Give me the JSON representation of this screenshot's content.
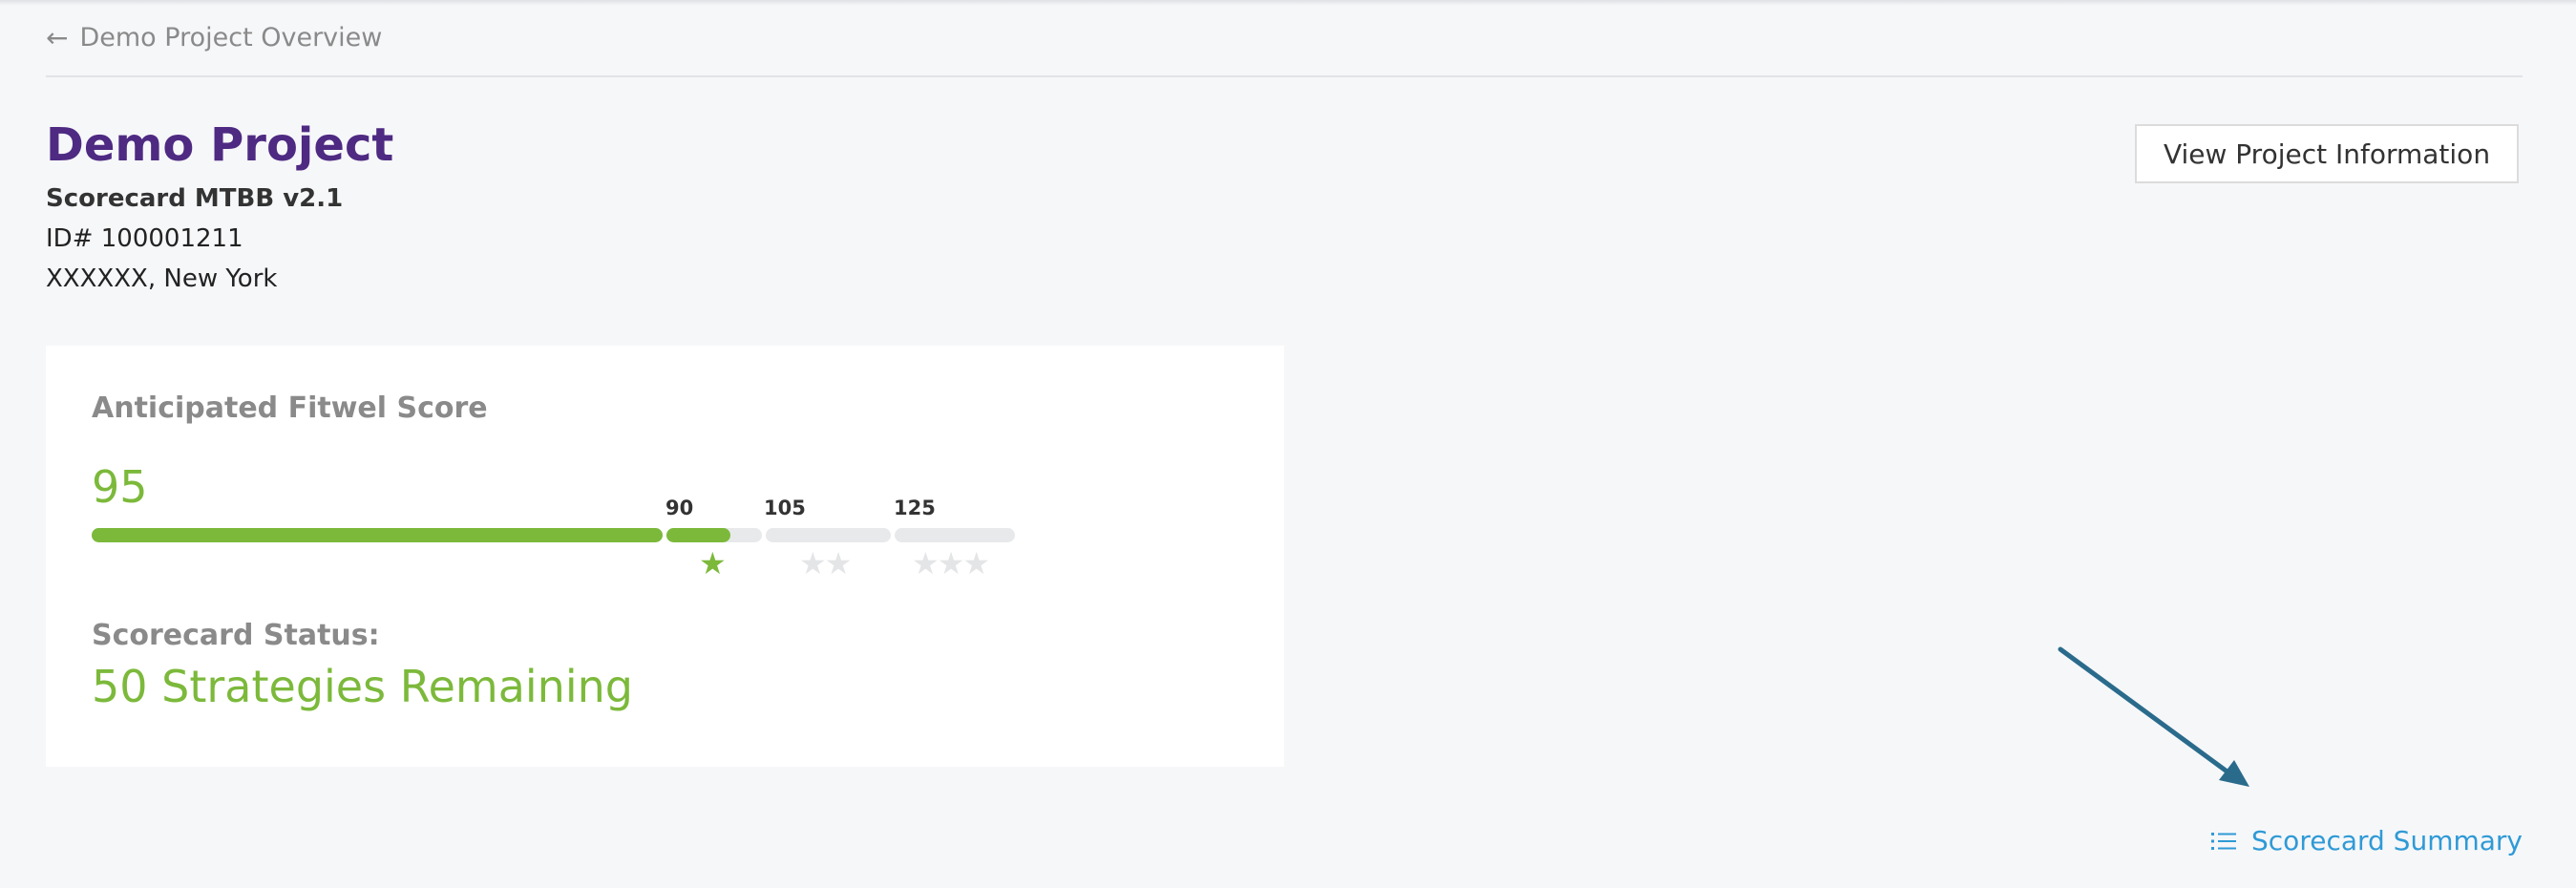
{
  "breadcrumb": {
    "label": "Demo Project Overview"
  },
  "project": {
    "title": "Demo Project",
    "scorecard": "Scorecard MTBB v2.1",
    "id": "ID# 100001211",
    "location": "XXXXXX, New York"
  },
  "header": {
    "view_info_label": "View Project Information"
  },
  "score_card": {
    "score_label": "Anticipated Fitwel Score",
    "score_value": "95",
    "score_numeric": 95,
    "tiers": [
      {
        "label": "90",
        "threshold": 90,
        "stars": 1
      },
      {
        "label": "105",
        "threshold": 105,
        "stars": 2
      },
      {
        "label": "125",
        "threshold": 125,
        "stars": 3
      }
    ],
    "stars_earned": 1,
    "status_label": "Scorecard Status:",
    "status_value": "50 Strategies Remaining"
  },
  "summary_link": {
    "label": "Scorecard Summary",
    "icon": "list-icon"
  },
  "colors": {
    "brand_purple": "#4e2a82",
    "score_green": "#7cb93b",
    "link_blue": "#2f9ad6",
    "annotation_arrow": "#2a6b8c"
  }
}
